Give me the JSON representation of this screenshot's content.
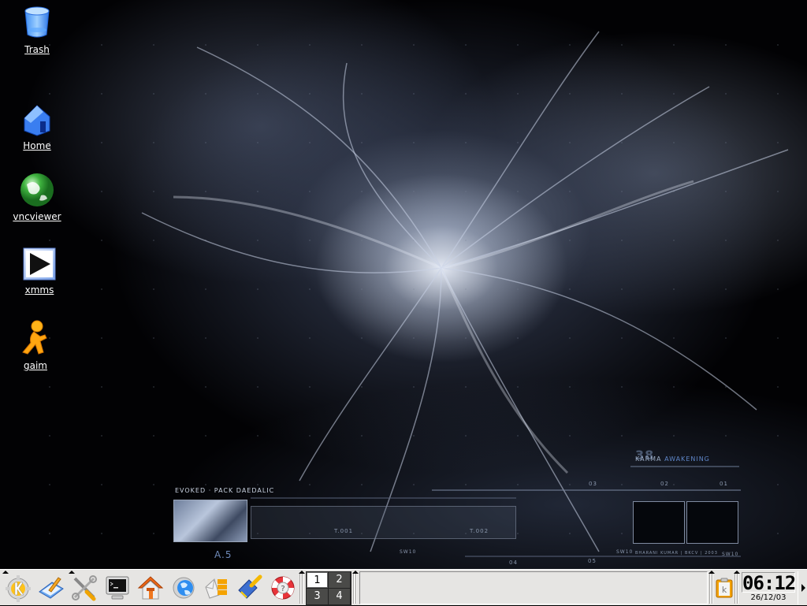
{
  "desktop": {
    "icons": [
      {
        "label": "Trash",
        "icon": "trash-icon"
      },
      {
        "label": "Home",
        "icon": "home-folder-icon"
      },
      {
        "label": "vncviewer",
        "icon": "globe-icon"
      },
      {
        "label": "xmms",
        "icon": "play-icon"
      },
      {
        "label": "gaim",
        "icon": "running-man-icon"
      }
    ],
    "wallpaper": {
      "title_prefix": "EVOKED",
      "title_suffix": "· PACK DAEDALIC",
      "code": "A.5",
      "t1": "T.001",
      "t2": "T.002",
      "karma_number": "38",
      "karma_a": "KARMA",
      "karma_b": "AWAKENING",
      "credit": "BHARANI KUMAR | BKCV | 2003",
      "sw1": "SW10",
      "sw2": "SW10",
      "sw3": "SW10",
      "n01": "01",
      "n02": "02",
      "n03": "03",
      "n04": "04",
      "n05": "05"
    }
  },
  "panel": {
    "launchers": [
      {
        "name": "kde-menu",
        "icon": "kde-gear-icon"
      },
      {
        "name": "editor",
        "icon": "pencil-paper-icon"
      },
      {
        "name": "control-center",
        "icon": "tools-icon"
      },
      {
        "name": "terminal",
        "icon": "terminal-icon"
      },
      {
        "name": "home",
        "icon": "home-icon"
      },
      {
        "name": "browser",
        "icon": "konqueror-globe-icon"
      },
      {
        "name": "mail",
        "icon": "mail-icon"
      },
      {
        "name": "office",
        "icon": "office-brush-icon"
      },
      {
        "name": "help",
        "icon": "lifebuoy-help-icon"
      }
    ],
    "pager": {
      "desktops": [
        "1",
        "2",
        "3",
        "4"
      ],
      "active": "1"
    },
    "systray": {
      "clipboard": "klipper-icon"
    },
    "clock": {
      "time": "06:12",
      "date": "26/12/03"
    }
  }
}
